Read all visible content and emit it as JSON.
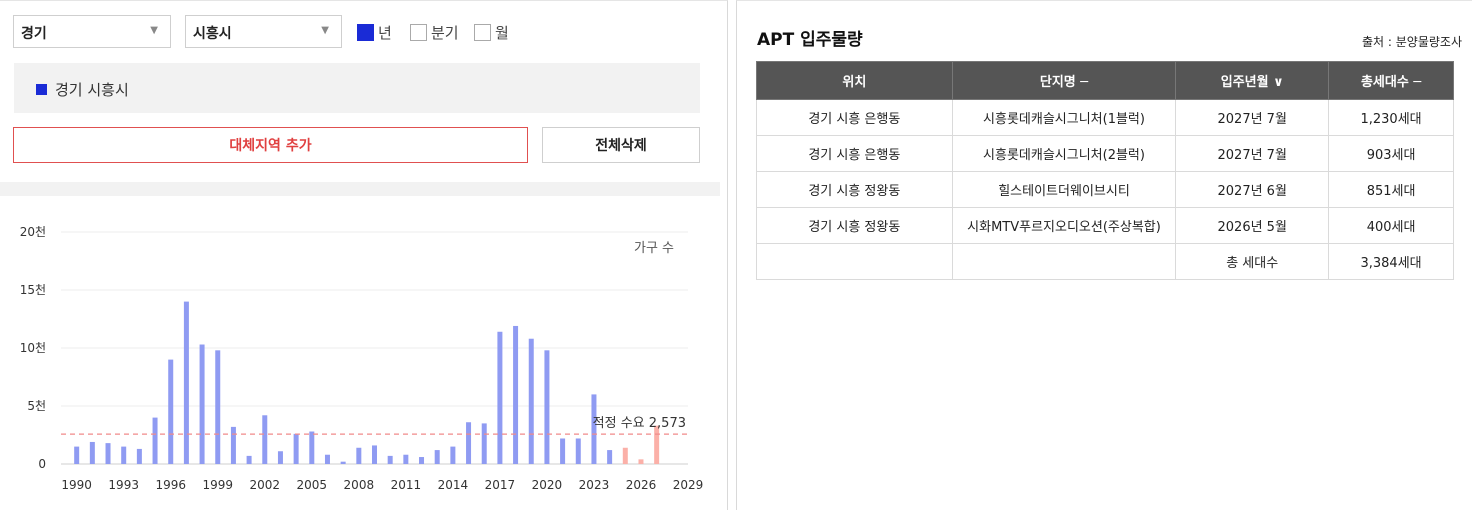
{
  "filters": {
    "province": "경기",
    "city": "시흥시",
    "period_options": [
      {
        "label": "년",
        "checked": true
      },
      {
        "label": "분기",
        "checked": false
      },
      {
        "label": "월",
        "checked": false
      }
    ]
  },
  "region_panel": {
    "selected": "경기 시흥시"
  },
  "buttons": {
    "add_region": "대체지역 추가",
    "delete_all": "전체삭제"
  },
  "colors": {
    "actual": "#8f9bf2",
    "forecast": "#fbb0a8",
    "demand_line": "#f08a8a",
    "checkbox_on": "#1a2bd6",
    "add_border": "#e05050"
  },
  "chart_data": {
    "type": "bar",
    "series_label": "가구 수",
    "y_ticks": [
      "20천",
      "15천",
      "10천",
      "5천",
      "0"
    ],
    "ylim": [
      0,
      20000
    ],
    "x_ticks": [
      "1990",
      "1993",
      "1996",
      "1999",
      "2002",
      "2005",
      "2008",
      "2011",
      "2014",
      "2017",
      "2020",
      "2023",
      "2026",
      "2029"
    ],
    "xlim": [
      1989,
      2029
    ],
    "years": [
      1990,
      1991,
      1992,
      1993,
      1994,
      1995,
      1996,
      1997,
      1998,
      1999,
      2000,
      2001,
      2002,
      2003,
      2004,
      2005,
      2006,
      2007,
      2008,
      2009,
      2010,
      2011,
      2012,
      2013,
      2014,
      2015,
      2016,
      2017,
      2018,
      2019,
      2020,
      2021,
      2022,
      2023,
      2024,
      2025,
      2026,
      2027
    ],
    "values": [
      1500,
      1900,
      1800,
      1500,
      1300,
      4000,
      9000,
      14000,
      10300,
      9800,
      3200,
      700,
      4200,
      1100,
      2600,
      2800,
      800,
      200,
      1400,
      1600,
      700,
      800,
      600,
      1200,
      1500,
      3600,
      3500,
      11400,
      11900,
      10800,
      9800,
      2200,
      2200,
      6000,
      1200,
      1400,
      400,
      3300
    ],
    "forecast_from": 2025,
    "demand": {
      "label": "적정 수요 2,573",
      "value": 2573
    }
  },
  "supply": {
    "title": "APT 입주물량",
    "source": "출처 : 분양물량조사",
    "headers": [
      "위치",
      "단지명 ─",
      "입주년월 ∨",
      "총세대수 ─"
    ],
    "rows": [
      [
        "경기 시흥 은행동",
        "시흥롯데캐슬시그니처(1블럭)",
        "2027년 7월",
        "1,230세대"
      ],
      [
        "경기 시흥 은행동",
        "시흥롯데캐슬시그니처(2블럭)",
        "2027년 7월",
        "903세대"
      ],
      [
        "경기 시흥 정왕동",
        "힐스테이트더웨이브시티",
        "2027년 6월",
        "851세대"
      ],
      [
        "경기 시흥 정왕동",
        "시화MTV푸르지오디오션(주상복합)",
        "2026년 5월",
        "400세대"
      ]
    ],
    "total_label": "총 세대수",
    "total_value": "3,384세대"
  }
}
